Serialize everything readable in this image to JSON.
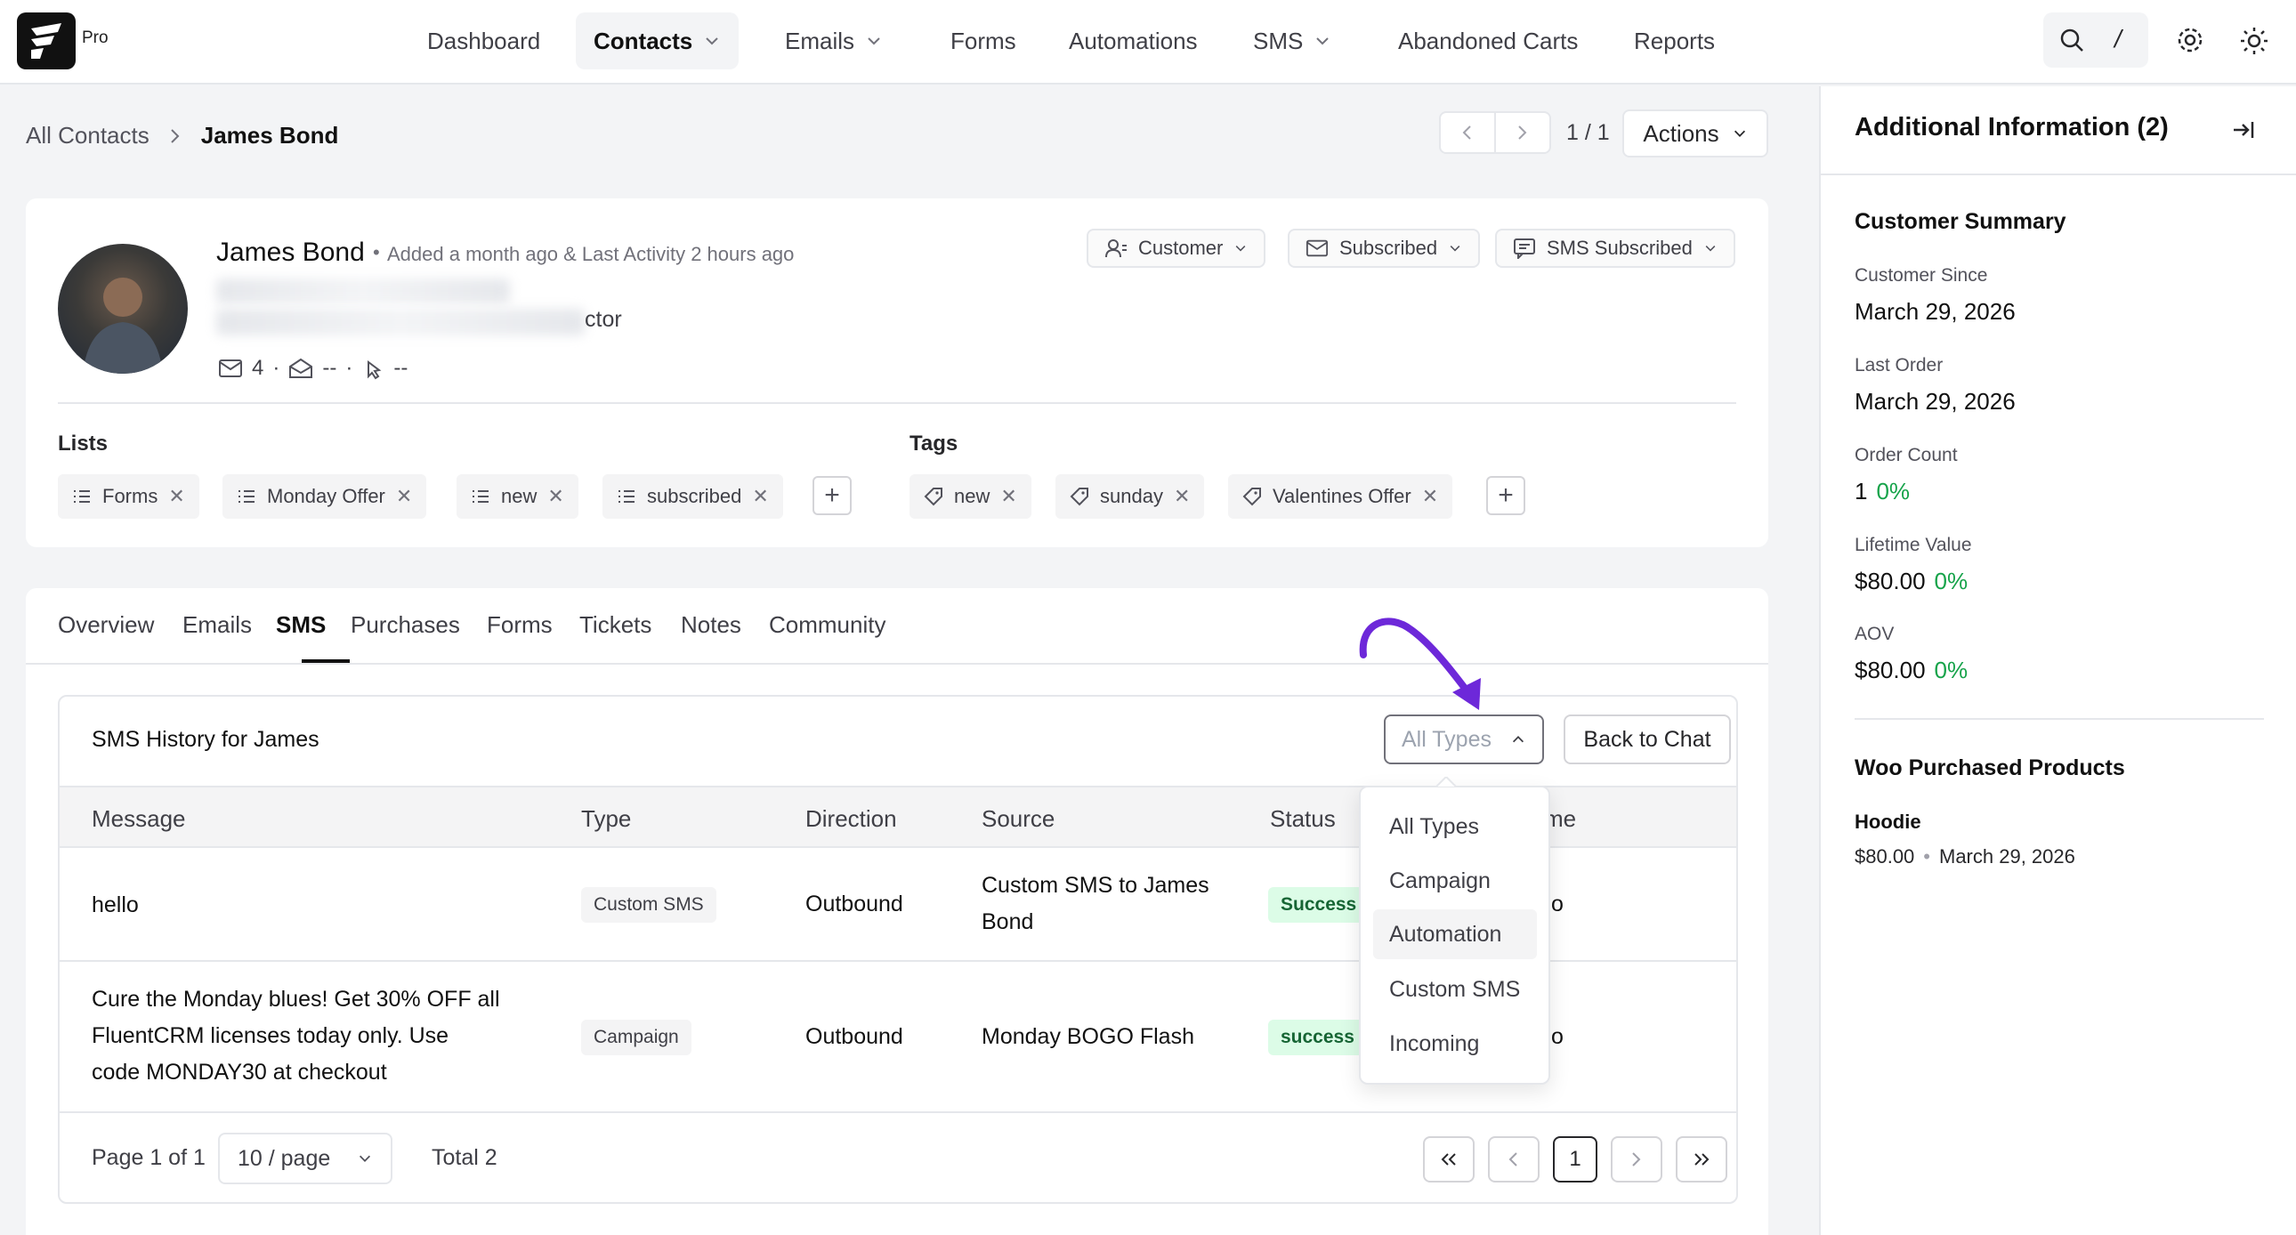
{
  "app": {
    "badge": "Pro"
  },
  "nav": {
    "dashboard": "Dashboard",
    "contacts": "Contacts",
    "emails": "Emails",
    "forms": "Forms",
    "automations": "Automations",
    "sms": "SMS",
    "abandoned_carts": "Abandoned Carts",
    "reports": "Reports"
  },
  "toolbar": {
    "shortcut": "/"
  },
  "breadcrumb": {
    "parent": "All Contacts",
    "current": "James Bond"
  },
  "pagination_top": {
    "count": "1 / 1",
    "actions_label": "Actions"
  },
  "contact": {
    "name": "James Bond",
    "meta": "Added a month ago & Last Activity 2 hours ago",
    "title_suffix": "ctor",
    "emails_count": "4",
    "opens": "--",
    "clicks": "--",
    "type_label": "Customer",
    "email_status": "Subscribed",
    "sms_status": "SMS Subscribed"
  },
  "lists": {
    "title": "Lists",
    "items": [
      "Forms",
      "Monday Offer",
      "new",
      "subscribed"
    ]
  },
  "tags": {
    "title": "Tags",
    "items": [
      "new",
      "sunday",
      "Valentines Offer"
    ]
  },
  "tabs": [
    "Overview",
    "Emails",
    "SMS",
    "Purchases",
    "Forms",
    "Tickets",
    "Notes",
    "Community"
  ],
  "sms_history": {
    "title": "SMS History for James",
    "filter_value": "All Types",
    "back_label": "Back to Chat",
    "columns": {
      "message": "Message",
      "type": "Type",
      "direction": "Direction",
      "source": "Source",
      "status": "Status",
      "time_partial": "me"
    },
    "rows": [
      {
        "message_lines": [
          "hello"
        ],
        "type": "Custom SMS",
        "direction": "Outbound",
        "source_lines": [
          "Custom SMS to James",
          "Bond"
        ],
        "status": "Success",
        "time_partial": "o"
      },
      {
        "message_lines": [
          "Cure the Monday blues! Get 30% OFF all",
          "FluentCRM licenses today only. Use",
          "code MONDAY30 at checkout"
        ],
        "type": "Campaign",
        "direction": "Outbound",
        "source_lines": [
          "Monday BOGO Flash"
        ],
        "status": "success",
        "time_partial": "o"
      }
    ],
    "footer": {
      "page_text": "Page 1 of 1",
      "per_page": "10 / page",
      "total": "Total 2",
      "current_page": "1"
    }
  },
  "type_dropdown": {
    "options": [
      "All Types",
      "Campaign",
      "Automation",
      "Custom SMS",
      "Incoming"
    ],
    "highlighted": "Automation"
  },
  "annotation": {
    "arrow_color": "#6d28d9"
  },
  "side_panel": {
    "title": "Additional Information (2)",
    "summary_title": "Customer Summary",
    "customer_since_label": "Customer Since",
    "customer_since": "March 29, 2026",
    "last_order_label": "Last Order",
    "last_order": "March 29, 2026",
    "order_count_label": "Order Count",
    "order_count": "1",
    "order_count_pct": "0%",
    "lifetime_label": "Lifetime Value",
    "lifetime_value": "$80.00",
    "lifetime_pct": "0%",
    "aov_label": "AOV",
    "aov_value": "$80.00",
    "aov_pct": "0%",
    "products_title": "Woo Purchased Products",
    "product_name": "Hoodie",
    "product_price": "$80.00",
    "product_date": "March 29, 2026"
  },
  "colors": {
    "accent_green": "#16a34a",
    "status_bg": "#dcfce7",
    "text": "#1f2937"
  }
}
